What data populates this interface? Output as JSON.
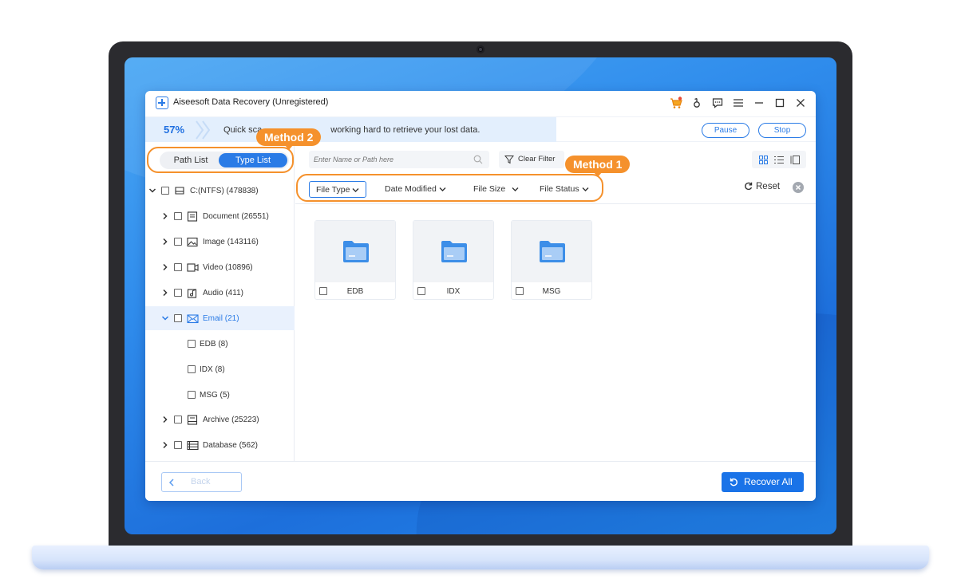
{
  "app": {
    "title": "Aiseesoft Data Recovery (Unregistered)"
  },
  "titlebar_icons": [
    "cart-icon",
    "key-icon",
    "feedback-icon",
    "menu-icon",
    "minimize-icon",
    "maximize-icon",
    "close-icon"
  ],
  "progress": {
    "percent_label": "57%",
    "percent_value": 0.57,
    "message": "Quick sca                   working hard to retrieve your lost data.",
    "message_visible": "Quick sca",
    "message_rest": "working hard to retrieve your lost data.",
    "pause_label": "Pause",
    "stop_label": "Stop"
  },
  "sidebar": {
    "path_list_label": "Path List",
    "type_list_label": "Type List",
    "selected_view": "Type List",
    "tree": [
      {
        "label": "C:(NTFS) (478838)",
        "level": 0,
        "expanded": true,
        "icon": "drive-icon"
      },
      {
        "label": "Document (26551)",
        "level": 1,
        "expanded": false,
        "icon": "document-icon"
      },
      {
        "label": "Image (143116)",
        "level": 1,
        "expanded": false,
        "icon": "image-icon"
      },
      {
        "label": "Video (10896)",
        "level": 1,
        "expanded": false,
        "icon": "video-icon"
      },
      {
        "label": "Audio (411)",
        "level": 1,
        "expanded": false,
        "icon": "audio-icon"
      },
      {
        "label": "Email (21)",
        "level": 1,
        "expanded": true,
        "active": true,
        "icon": "email-icon"
      },
      {
        "label": "EDB (8)",
        "level": 2
      },
      {
        "label": "IDX (8)",
        "level": 2
      },
      {
        "label": "MSG (5)",
        "level": 2
      },
      {
        "label": "Archive (25223)",
        "level": 1,
        "expanded": false,
        "icon": "archive-icon"
      },
      {
        "label": "Database (562)",
        "level": 1,
        "expanded": false,
        "icon": "database-icon"
      }
    ]
  },
  "toolbar": {
    "search_placeholder": "Enter Name or Path here",
    "clear_filter_label": "Clear Filter"
  },
  "filters": {
    "file_type": "File Type",
    "date_modified": "Date Modified",
    "file_size": "File Size",
    "file_status": "File Status",
    "reset_label": "Reset"
  },
  "annotations": {
    "method1": "Method 1",
    "method2": "Method 2",
    "color": "#f5912c"
  },
  "files": [
    {
      "name": "EDB"
    },
    {
      "name": "IDX"
    },
    {
      "name": "MSG"
    }
  ],
  "footer": {
    "back_label": "Back",
    "recover_label": "Recover All"
  },
  "colors": {
    "accent": "#2a7be6",
    "primary_button": "#1a73e8",
    "annotation": "#f5912c"
  }
}
